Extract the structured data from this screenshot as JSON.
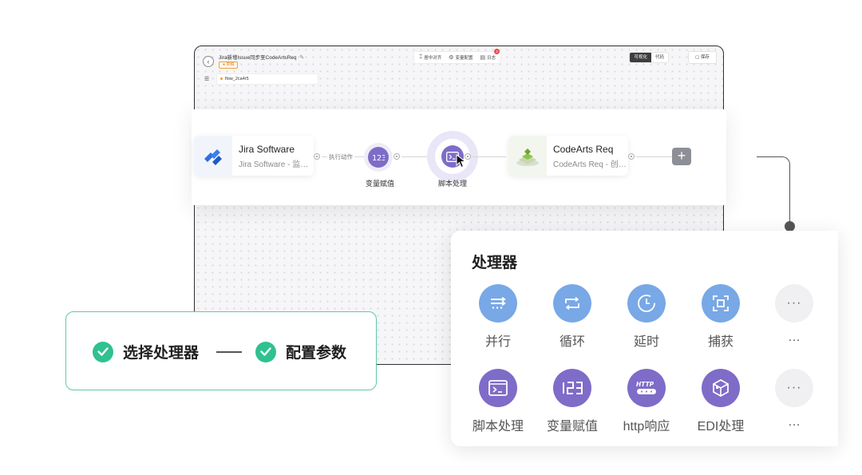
{
  "editor": {
    "back_icon": "arrow-left-icon",
    "flow_title": "Jira新增Issue同步至CodeArtsReq",
    "draft_badge": "● 草稿",
    "flow_chip": "flow_2ca4r5",
    "toolbar": {
      "center_items": [
        {
          "icon": "align-icon",
          "label": "居中对齐"
        },
        {
          "icon": "gear-icon",
          "label": "变量配置"
        },
        {
          "icon": "log-icon",
          "label": "日志",
          "badge": "2"
        }
      ],
      "view_visual": "可视化",
      "view_code": "代码",
      "save": "保存"
    }
  },
  "flow": {
    "trigger_node": {
      "name": "Jira Software",
      "subtitle": "Jira Software - 监…"
    },
    "action_label": "执行动作",
    "variable_node": {
      "label": "变量赋值"
    },
    "script_node": {
      "label": "脚本处理"
    },
    "target_node": {
      "name": "CodeArts Req",
      "subtitle": "CodeArts Req - 创…"
    },
    "add_node": "+"
  },
  "panel": {
    "title": "处理器",
    "items_row1": [
      {
        "label": "并行",
        "icon": "parallel-icon",
        "color": "blue"
      },
      {
        "label": "循环",
        "icon": "loop-icon",
        "color": "blue"
      },
      {
        "label": "延时",
        "icon": "clock-icon",
        "color": "blue"
      },
      {
        "label": "捕获",
        "icon": "capture-icon",
        "color": "blue"
      },
      {
        "label": "…",
        "icon": "more-icon",
        "color": "gray"
      }
    ],
    "items_row2": [
      {
        "label": "脚本处理",
        "icon": "terminal-icon",
        "color": "purple"
      },
      {
        "label": "变量赋值",
        "icon": "number-icon",
        "color": "purple"
      },
      {
        "label": "http响应",
        "icon": "http-icon",
        "color": "purple"
      },
      {
        "label": "EDI处理",
        "icon": "cube-icon",
        "color": "purple"
      },
      {
        "label": "…",
        "icon": "more-icon",
        "color": "gray"
      }
    ]
  },
  "steps": {
    "step1": "选择处理器",
    "step2": "配置参数"
  },
  "colors": {
    "blue_icon": "#78a8e6",
    "purple_icon": "#7e6cc8",
    "check_green": "#2fc18f",
    "step_border": "#5ec9a7"
  }
}
